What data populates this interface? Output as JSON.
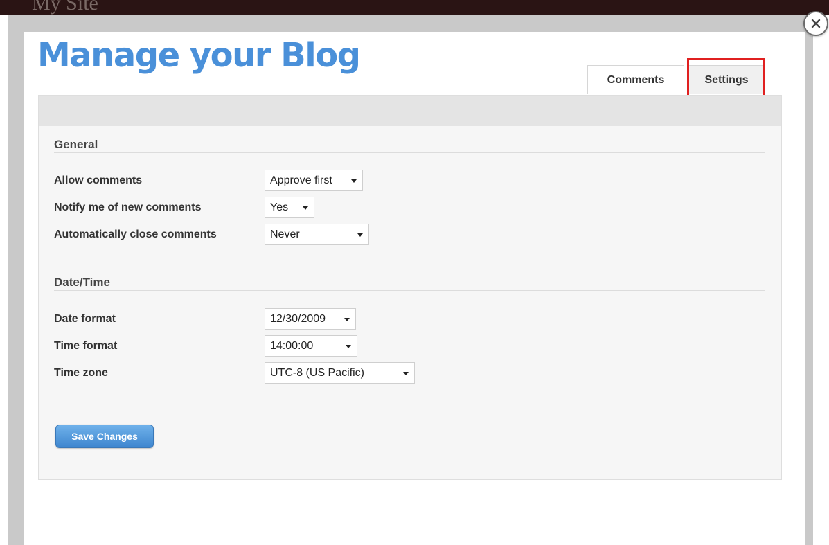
{
  "background": {
    "site_title": "My Site"
  },
  "modal": {
    "title": "Manage your Blog",
    "close_icon": "close-icon",
    "tabs": [
      {
        "label": "Comments",
        "active": false
      },
      {
        "label": "Settings",
        "active": true,
        "highlighted": true
      }
    ]
  },
  "general": {
    "title": "General",
    "rows": [
      {
        "label": "Allow comments",
        "value": "Approve first"
      },
      {
        "label": "Notify me of new comments",
        "value": "Yes"
      },
      {
        "label": "Automatically close comments",
        "value": "Never"
      }
    ]
  },
  "datetime": {
    "title": "Date/Time",
    "rows": [
      {
        "label": "Date format",
        "value": "12/30/2009"
      },
      {
        "label": "Time format",
        "value": "14:00:00"
      },
      {
        "label": "Time zone",
        "value": "UTC-8 (US Pacific)"
      }
    ]
  },
  "actions": {
    "save_label": "Save Changes"
  },
  "colors": {
    "title_blue": "#4a90d9",
    "button_blue": "#3e86cf",
    "highlight_red": "#e02020"
  }
}
